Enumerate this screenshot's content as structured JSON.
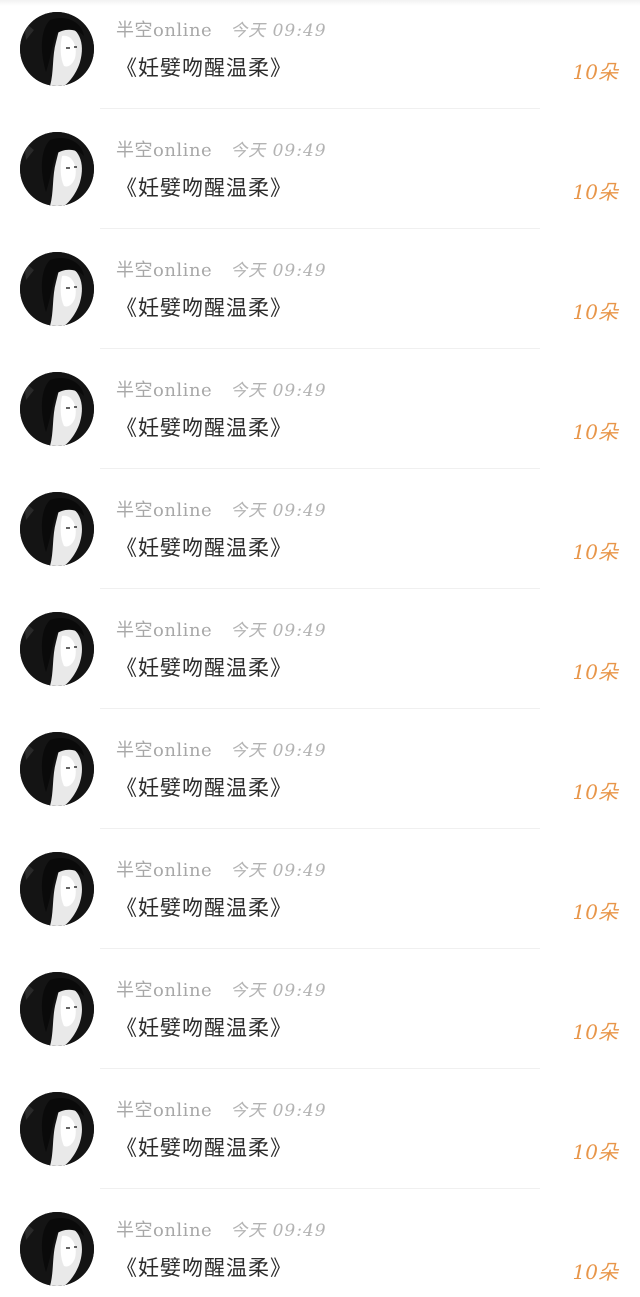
{
  "list": {
    "items": [
      {
        "sender": "半空online",
        "time": "今天 09:49",
        "gift": "《妊嬖吻醒温柔》",
        "count": "10朵"
      },
      {
        "sender": "半空online",
        "time": "今天 09:49",
        "gift": "《妊嬖吻醒温柔》",
        "count": "10朵"
      },
      {
        "sender": "半空online",
        "time": "今天 09:49",
        "gift": "《妊嬖吻醒温柔》",
        "count": "10朵"
      },
      {
        "sender": "半空online",
        "time": "今天 09:49",
        "gift": "《妊嬖吻醒温柔》",
        "count": "10朵"
      },
      {
        "sender": "半空online",
        "time": "今天 09:49",
        "gift": "《妊嬖吻醒温柔》",
        "count": "10朵"
      },
      {
        "sender": "半空online",
        "time": "今天 09:49",
        "gift": "《妊嬖吻醒温柔》",
        "count": "10朵"
      },
      {
        "sender": "半空online",
        "time": "今天 09:49",
        "gift": "《妊嬖吻醒温柔》",
        "count": "10朵"
      },
      {
        "sender": "半空online",
        "time": "今天 09:49",
        "gift": "《妊嬖吻醒温柔》",
        "count": "10朵"
      },
      {
        "sender": "半空online",
        "time": "今天 09:49",
        "gift": "《妊嬖吻醒温柔》",
        "count": "10朵"
      },
      {
        "sender": "半空online",
        "time": "今天 09:49",
        "gift": "《妊嬖吻醒温柔》",
        "count": "10朵"
      },
      {
        "sender": "半空online",
        "time": "今天 09:49",
        "gift": "《妊嬖吻醒温柔》",
        "count": "10朵"
      }
    ]
  },
  "colors": {
    "count_accent": "#e8964a",
    "meta_gray": "#a8a8a8",
    "gift_text": "#2b2b2b"
  },
  "icons": {
    "avatar": "user-avatar-image"
  }
}
